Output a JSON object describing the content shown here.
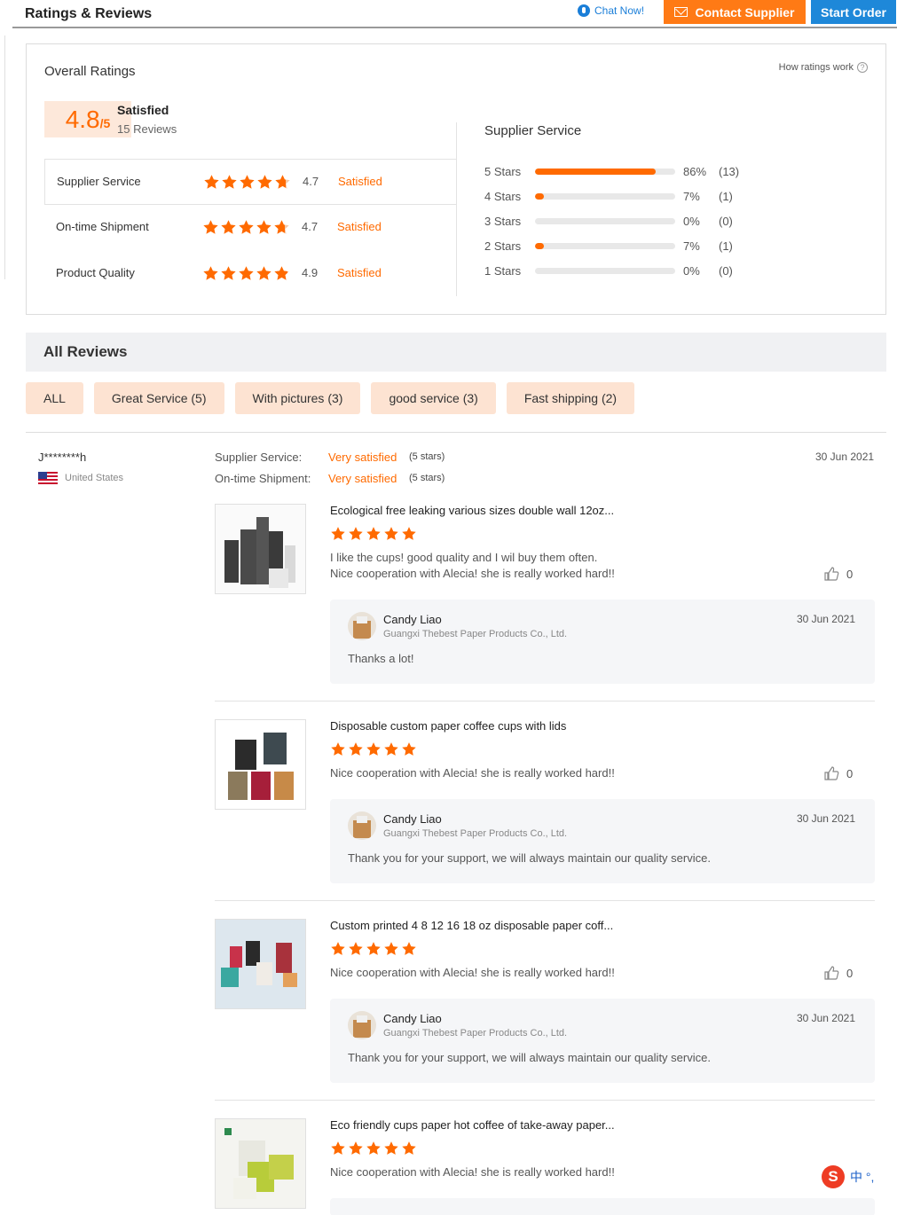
{
  "header": {
    "title": "Ratings & Reviews",
    "chat_label": "Chat Now!",
    "contact_label": "Contact Supplier",
    "start_label": "Start Order"
  },
  "overall": {
    "title": "Overall Ratings",
    "score": "4.8",
    "score_max": "/5",
    "status": "Satisfied",
    "reviews": "15 Reviews",
    "how_label": "How ratings work",
    "dimensions": [
      {
        "label": "Supplier Service",
        "rating": 4.7,
        "value": "4.7",
        "status": "Satisfied"
      },
      {
        "label": "On-time Shipment",
        "rating": 4.7,
        "value": "4.7",
        "status": "Satisfied"
      },
      {
        "label": "Product Quality",
        "rating": 4.9,
        "value": "4.9",
        "status": "Satisfied"
      }
    ],
    "service_title": "Supplier Service",
    "breakdown": [
      {
        "label": "5  Stars",
        "fraction": 0.86,
        "pct": "86%",
        "count": "(13)"
      },
      {
        "label": "4  Stars",
        "fraction": 0.07,
        "pct": "7%",
        "count": "(1)"
      },
      {
        "label": "3  Stars",
        "fraction": 0,
        "pct": "0%",
        "count": "(0)"
      },
      {
        "label": "2  Stars",
        "fraction": 0.07,
        "pct": "7%",
        "count": "(1)"
      },
      {
        "label": "1  Stars",
        "fraction": 0,
        "pct": "0%",
        "count": "(0)"
      }
    ]
  },
  "all_reviews": {
    "title": "All Reviews",
    "filters": [
      "ALL",
      "Great Service (5)",
      "With pictures (3)",
      "good service (3)",
      "Fast shipping (2)"
    ]
  },
  "review": {
    "user": "J********h",
    "country": "United States",
    "date": "30 Jun 2021",
    "service_label": "Supplier Service:",
    "service_value": "Very satisfied",
    "service_stars": "(5 stars)",
    "shipment_label": "On-time Shipment:",
    "shipment_value": "Very satisfied",
    "shipment_stars": "(5 stars)",
    "items": [
      {
        "title": "Ecological free leaking various sizes double wall 12oz...",
        "comment1": "I like the cups! good quality and I wil buy them often.",
        "comment2": "Nice cooperation with Alecia! she is really worked hard!!",
        "likes": "0",
        "reply_name": "Candy Liao",
        "reply_company": "Guangxi Thebest Paper Products Co., Ltd.",
        "reply_date": "30 Jun 2021",
        "reply_text": "Thanks a lot!"
      },
      {
        "title": "Disposable custom paper coffee cups with lids",
        "comment1": "Nice cooperation with Alecia! she is really worked hard!!",
        "likes": "0",
        "reply_name": "Candy Liao",
        "reply_company": "Guangxi Thebest Paper Products Co., Ltd.",
        "reply_date": "30 Jun 2021",
        "reply_text": "Thank you for your support, we will always maintain our quality service."
      },
      {
        "title": "Custom printed 4 8 12 16 18 oz disposable paper coff...",
        "comment1": "Nice cooperation with Alecia! she is really worked hard!!",
        "likes": "0",
        "reply_name": "Candy Liao",
        "reply_company": "Guangxi Thebest Paper Products Co., Ltd.",
        "reply_date": "30 Jun 2021",
        "reply_text": "Thank you for your support, we will always maintain our quality service."
      },
      {
        "title": "Eco friendly cups paper hot coffee of take-away paper...",
        "comment1": "Nice cooperation with Alecia! she is really worked hard!!"
      }
    ]
  },
  "ime": {
    "chars": "中 °,"
  },
  "colors": {
    "accent": "#ff6a00",
    "contact_btn": "#ff7a15",
    "start_btn": "#1e88d9",
    "chip_bg": "#fde3d2"
  }
}
